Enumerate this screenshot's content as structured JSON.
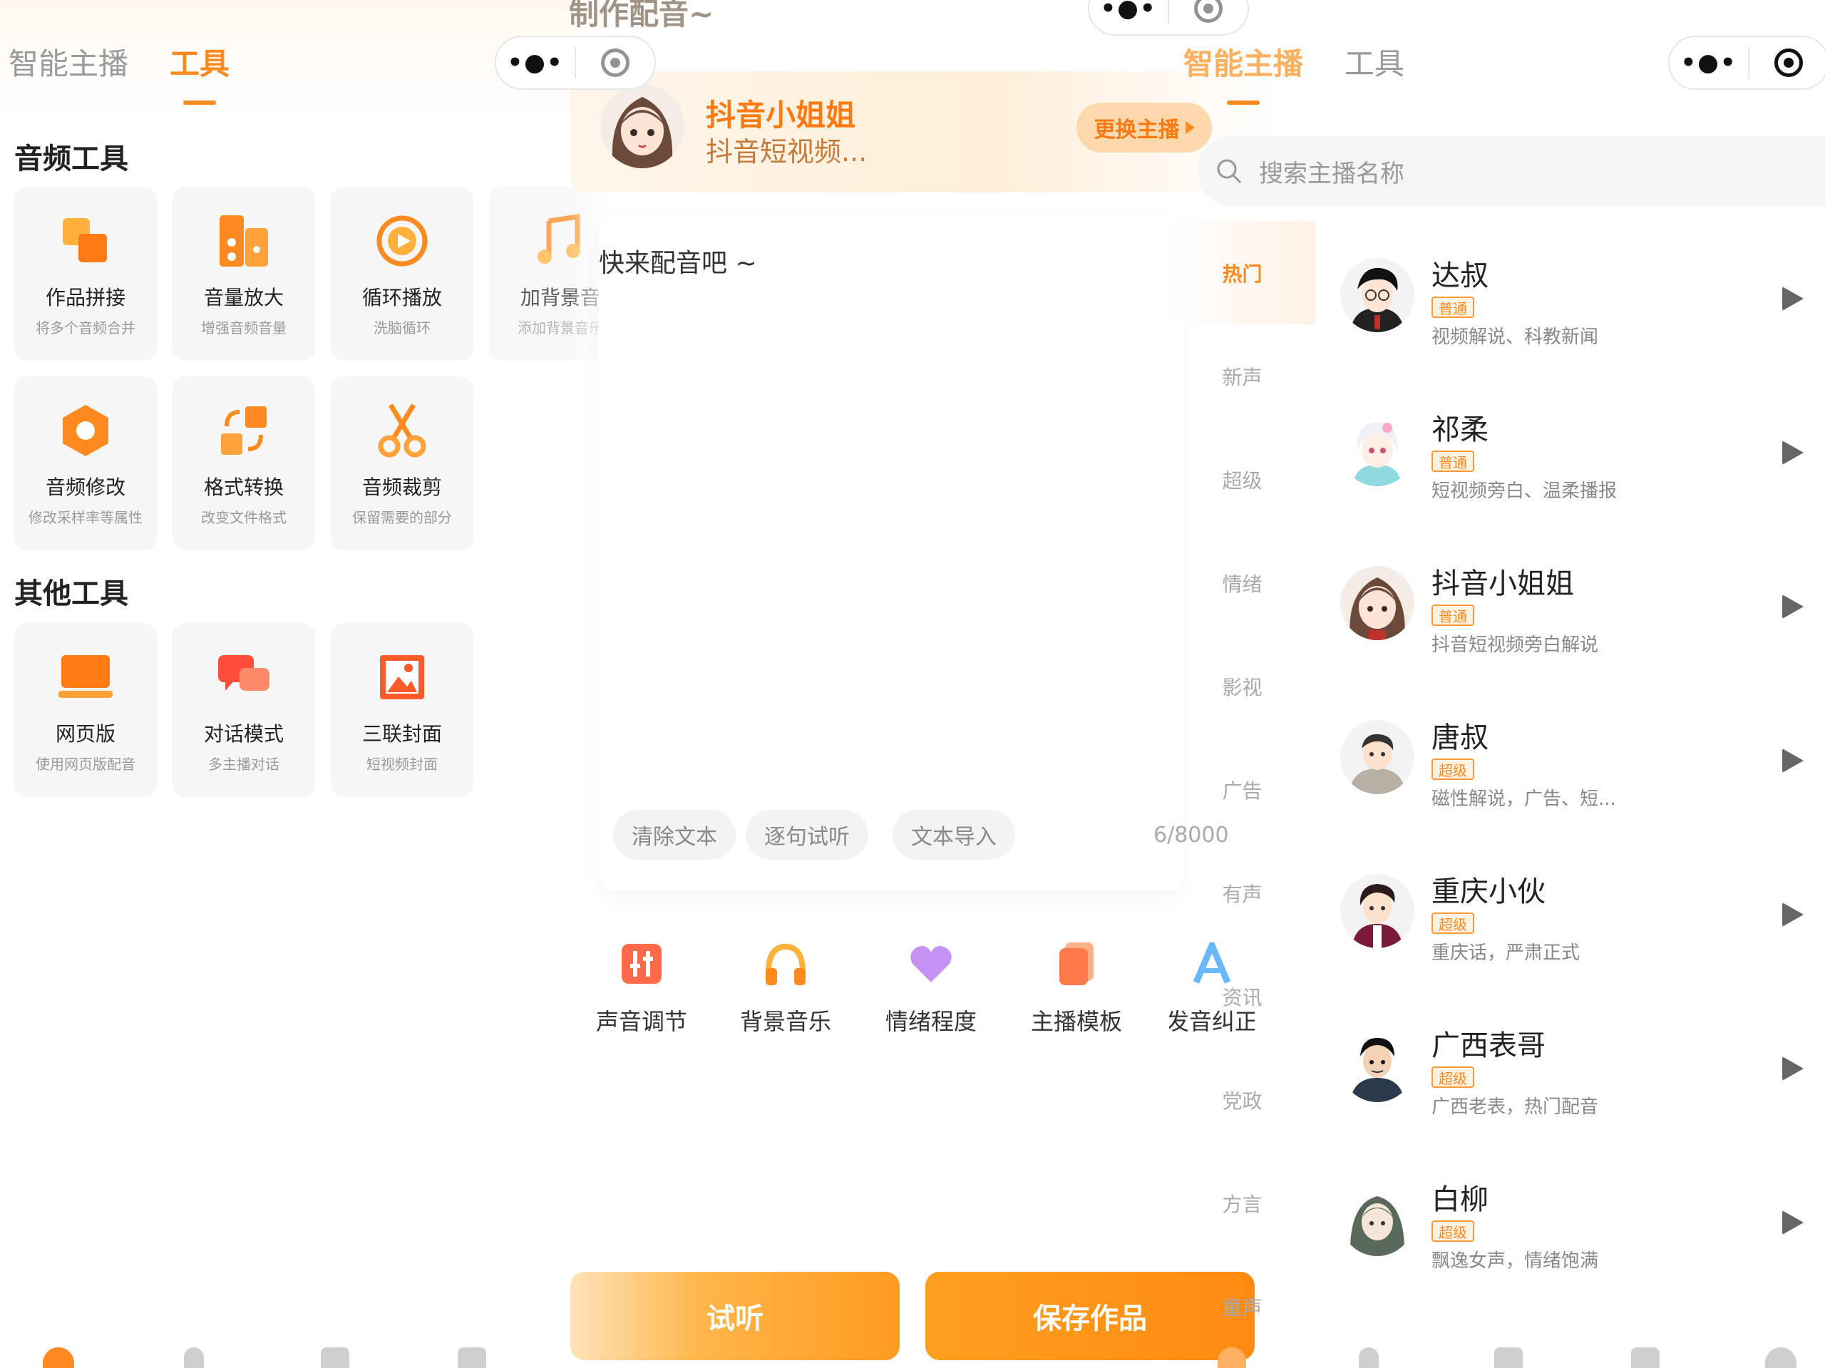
{
  "left_panel": {
    "tabs": [
      "智能主播",
      "工具"
    ],
    "active_tab": "工具",
    "audio_tools_title": "音频工具",
    "audio_tools": [
      {
        "name": "作品拼接",
        "desc": "将多个音频合并",
        "icon": "merge-icon"
      },
      {
        "name": "音量放大",
        "desc": "增强音频音量",
        "icon": "speaker-icon"
      },
      {
        "name": "循环播放",
        "desc": "洗脑循环",
        "icon": "loop-icon"
      },
      {
        "name": "加背景音",
        "desc": "添加背景音乐",
        "icon": "music-note-icon"
      },
      {
        "name": "音频修改",
        "desc": "修改采样率等属性",
        "icon": "hexagon-icon"
      },
      {
        "name": "格式转换",
        "desc": "改变文件格式",
        "icon": "convert-icon"
      },
      {
        "name": "音频裁剪",
        "desc": "保留需要的部分",
        "icon": "scissors-icon"
      }
    ],
    "other_tools_title": "其他工具",
    "other_tools": [
      {
        "name": "网页版",
        "desc": "使用网页版配音",
        "icon": "laptop-icon"
      },
      {
        "name": "对话模式",
        "desc": "多主播对话",
        "icon": "chat-icon"
      },
      {
        "name": "三联封面",
        "desc": "短视频封面",
        "icon": "image-icon"
      }
    ]
  },
  "middle_panel": {
    "title": "制作配音~",
    "current_anchor": {
      "name": "抖音小姐姐",
      "desc": "抖音短视频..."
    },
    "switch_label": "更换主播",
    "placeholder": "快来配音吧 ~",
    "text_actions": [
      "清除文本",
      "逐句试听",
      "文本导入"
    ],
    "char_count": "6/8000",
    "features": [
      {
        "name": "声音调节",
        "icon": "sliders-icon"
      },
      {
        "name": "背景音乐",
        "icon": "headphones-icon"
      },
      {
        "name": "情绪程度",
        "icon": "heart-icon"
      },
      {
        "name": "主播模板",
        "icon": "template-icon"
      },
      {
        "name": "发音纠正",
        "icon": "letter-a-icon"
      }
    ],
    "preview_label": "试听",
    "save_label": "保存作品"
  },
  "right_panel": {
    "tabs": [
      "智能主播",
      "工具"
    ],
    "active_tab": "智能主播",
    "search_placeholder": "搜索主播名称",
    "categories": [
      "热门",
      "新声",
      "超级",
      "情绪",
      "影视",
      "广告",
      "有声",
      "资讯",
      "党政",
      "方言",
      "童声"
    ],
    "active_category": "热门",
    "anchors": [
      {
        "name": "达叔",
        "level": "普通",
        "desc": "视频解说、科教新闻"
      },
      {
        "name": "祁柔",
        "level": "普通",
        "desc": "短视频旁白、温柔播报"
      },
      {
        "name": "抖音小姐姐",
        "level": "普通",
        "desc": "抖音短视频旁白解说"
      },
      {
        "name": "唐叔",
        "level": "超级",
        "desc": "磁性解说，广告、短..."
      },
      {
        "name": "重庆小伙",
        "level": "超级",
        "desc": "重庆话，严肃正式"
      },
      {
        "name": "广西表哥",
        "level": "超级",
        "desc": "广西老表，热门配音"
      },
      {
        "name": "白柳",
        "level": "超级",
        "desc": "飘逸女声，情绪饱满"
      }
    ]
  },
  "colors": {
    "accent": "#ff8a1f",
    "accent_light": "#ffd9ad",
    "muted": "#9a9a9a"
  }
}
